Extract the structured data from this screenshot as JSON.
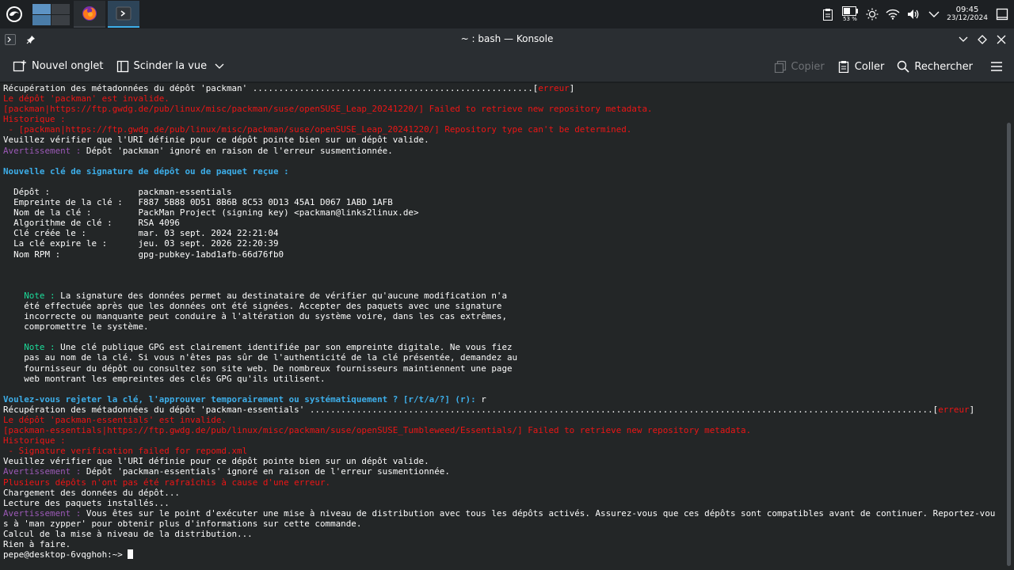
{
  "panel": {
    "icons": [
      "opensuse-launcher-icon",
      "firefox-icon",
      "konsole-icon"
    ],
    "tray": {
      "battery_percent": "53 %",
      "time": "09:45",
      "date": "23/12/2024"
    }
  },
  "window": {
    "title": "~ : bash — Konsole"
  },
  "toolbar": {
    "new_tab": "Nouvel onglet",
    "split_view": "Scinder la vue",
    "copy": "Copier",
    "paste": "Coller",
    "search": "Rechercher"
  },
  "terminal": {
    "lines": [
      {
        "segs": [
          {
            "t": "Récupération des métadonnées du dépôt 'packman' ......................................................["
          },
          {
            "t": "erreur",
            "c": "red"
          },
          {
            "t": "]"
          }
        ]
      },
      {
        "segs": [
          {
            "t": "Le dépôt 'packman' est invalide.",
            "c": "red"
          }
        ]
      },
      {
        "segs": [
          {
            "t": "[packman|https://ftp.gwdg.de/pub/linux/misc/packman/suse/openSUSE_Leap_20241220/] Failed to retrieve new repository metadata.",
            "c": "red"
          }
        ]
      },
      {
        "segs": [
          {
            "t": "Historique :",
            "c": "red"
          }
        ]
      },
      {
        "segs": [
          {
            "t": " - [packman|https://ftp.gwdg.de/pub/linux/misc/packman/suse/openSUSE_Leap_20241220/] Repository type can't be determined.",
            "c": "red"
          }
        ]
      },
      {
        "segs": [
          {
            "t": "Veuillez vérifier que l'URI définie pour ce dépôt pointe bien sur un dépôt valide."
          }
        ]
      },
      {
        "segs": [
          {
            "t": "Avertissement :",
            "c": "purple"
          },
          {
            "t": " Dépôt 'packman' ignoré en raison de l'erreur susmentionnée."
          }
        ]
      },
      {
        "segs": [
          {
            "t": ""
          }
        ]
      },
      {
        "segs": [
          {
            "t": "Nouvelle clé de signature de dépôt ou de paquet reçue :",
            "c": "blue"
          }
        ]
      },
      {
        "segs": [
          {
            "t": ""
          }
        ]
      },
      {
        "segs": [
          {
            "t": "  Dépôt :                 packman-essentials"
          }
        ]
      },
      {
        "segs": [
          {
            "t": "  Empreinte de la clé :   F887 5B88 0D51 8B6B 8C53 0D13 45A1 D067 1ABD 1AFB"
          }
        ]
      },
      {
        "segs": [
          {
            "t": "  Nom de la clé :         PackMan Project (signing key) <packman@links2linux.de>"
          }
        ]
      },
      {
        "segs": [
          {
            "t": "  Algorithme de clé :     RSA 4096"
          }
        ]
      },
      {
        "segs": [
          {
            "t": "  Clé créée le :          mar. 03 sept. 2024 22:21:04"
          }
        ]
      },
      {
        "segs": [
          {
            "t": "  La clé expire le :      jeu. 03 sept. 2026 22:20:39"
          }
        ]
      },
      {
        "segs": [
          {
            "t": "  Nom RPM :               gpg-pubkey-1abd1afb-66d76fb0"
          }
        ]
      },
      {
        "segs": [
          {
            "t": ""
          }
        ]
      },
      {
        "segs": [
          {
            "t": ""
          }
        ]
      },
      {
        "segs": [
          {
            "t": ""
          }
        ]
      },
      {
        "segs": [
          {
            "t": "    "
          },
          {
            "t": "Note :",
            "c": "green"
          },
          {
            "t": " La signature des données permet au destinataire de vérifier qu'aucune modification n'a"
          }
        ]
      },
      {
        "segs": [
          {
            "t": "    été effectuée après que les données ont été signées. Accepter des paquets avec une signature"
          }
        ]
      },
      {
        "segs": [
          {
            "t": "    incorrecte ou manquante peut conduire à l'altération du système voire, dans les cas extrêmes,"
          }
        ]
      },
      {
        "segs": [
          {
            "t": "    compromettre le système."
          }
        ]
      },
      {
        "segs": [
          {
            "t": ""
          }
        ]
      },
      {
        "segs": [
          {
            "t": "    "
          },
          {
            "t": "Note :",
            "c": "green"
          },
          {
            "t": " Une clé publique GPG est clairement identifiée par son empreinte digitale. Ne vous fiez"
          }
        ]
      },
      {
        "segs": [
          {
            "t": "    pas au nom de la clé. Si vous n'êtes pas sûr de l'authenticité de la clé présentée, demandez au"
          }
        ]
      },
      {
        "segs": [
          {
            "t": "    fournisseur du dépôt ou consultez son site web. De nombreux fournisseurs maintiennent une page"
          }
        ]
      },
      {
        "segs": [
          {
            "t": "    web montrant les empreintes des clés GPG qu'ils utilisent."
          }
        ]
      },
      {
        "segs": [
          {
            "t": ""
          }
        ]
      },
      {
        "segs": [
          {
            "t": "Voulez-vous rejeter la clé, l'approuver temporairement ou systématiquement ? [r/t/a/?] (r):",
            "c": "blue"
          },
          {
            "t": " r"
          }
        ]
      },
      {
        "segs": [
          {
            "t": "Récupération des métadonnées du dépôt 'packman-essentials' ........................................................................................................................["
          },
          {
            "t": "erreur",
            "c": "red"
          },
          {
            "t": "]"
          }
        ]
      },
      {
        "segs": [
          {
            "t": "Le dépôt 'packman-essentials' est invalide.",
            "c": "red"
          }
        ]
      },
      {
        "segs": [
          {
            "t": "[packman-essentials|https://ftp.gwdg.de/pub/linux/misc/packman/suse/openSUSE_Tumbleweed/Essentials/] Failed to retrieve new repository metadata.",
            "c": "red"
          }
        ]
      },
      {
        "segs": [
          {
            "t": "Historique :",
            "c": "red"
          }
        ]
      },
      {
        "segs": [
          {
            "t": " - Signature verification failed for repomd.xml",
            "c": "red"
          }
        ]
      },
      {
        "segs": [
          {
            "t": "Veuillez vérifier que l'URI définie pour ce dépôt pointe bien sur un dépôt valide."
          }
        ]
      },
      {
        "segs": [
          {
            "t": "Avertissement :",
            "c": "purple"
          },
          {
            "t": " Dépôt 'packman-essentials' ignoré en raison de l'erreur susmentionnée."
          }
        ]
      },
      {
        "segs": [
          {
            "t": "Plusieurs dépôts n'ont pas été rafraîchis à cause d'une erreur.",
            "c": "red"
          }
        ]
      },
      {
        "segs": [
          {
            "t": "Chargement des données du dépôt..."
          }
        ]
      },
      {
        "segs": [
          {
            "t": "Lecture des paquets installés..."
          }
        ]
      },
      {
        "segs": [
          {
            "t": "Avertissement :",
            "c": "purple"
          },
          {
            "t": " Vous êtes sur le point d'exécuter une mise à niveau de distribution avec tous les dépôts activés. Assurez-vous que ces dépôts sont compatibles avant de continuer. Reportez-vou"
          }
        ]
      },
      {
        "segs": [
          {
            "t": "s à 'man zypper' pour obtenir plus d'informations sur cette commande."
          }
        ]
      },
      {
        "segs": [
          {
            "t": "Calcul de la mise à niveau de la distribution..."
          }
        ]
      },
      {
        "segs": [
          {
            "t": "Rien à faire."
          }
        ]
      },
      {
        "segs": [
          {
            "t": "pepe@desktop-6vqghoh:~> "
          }
        ],
        "cursor": true
      }
    ]
  }
}
